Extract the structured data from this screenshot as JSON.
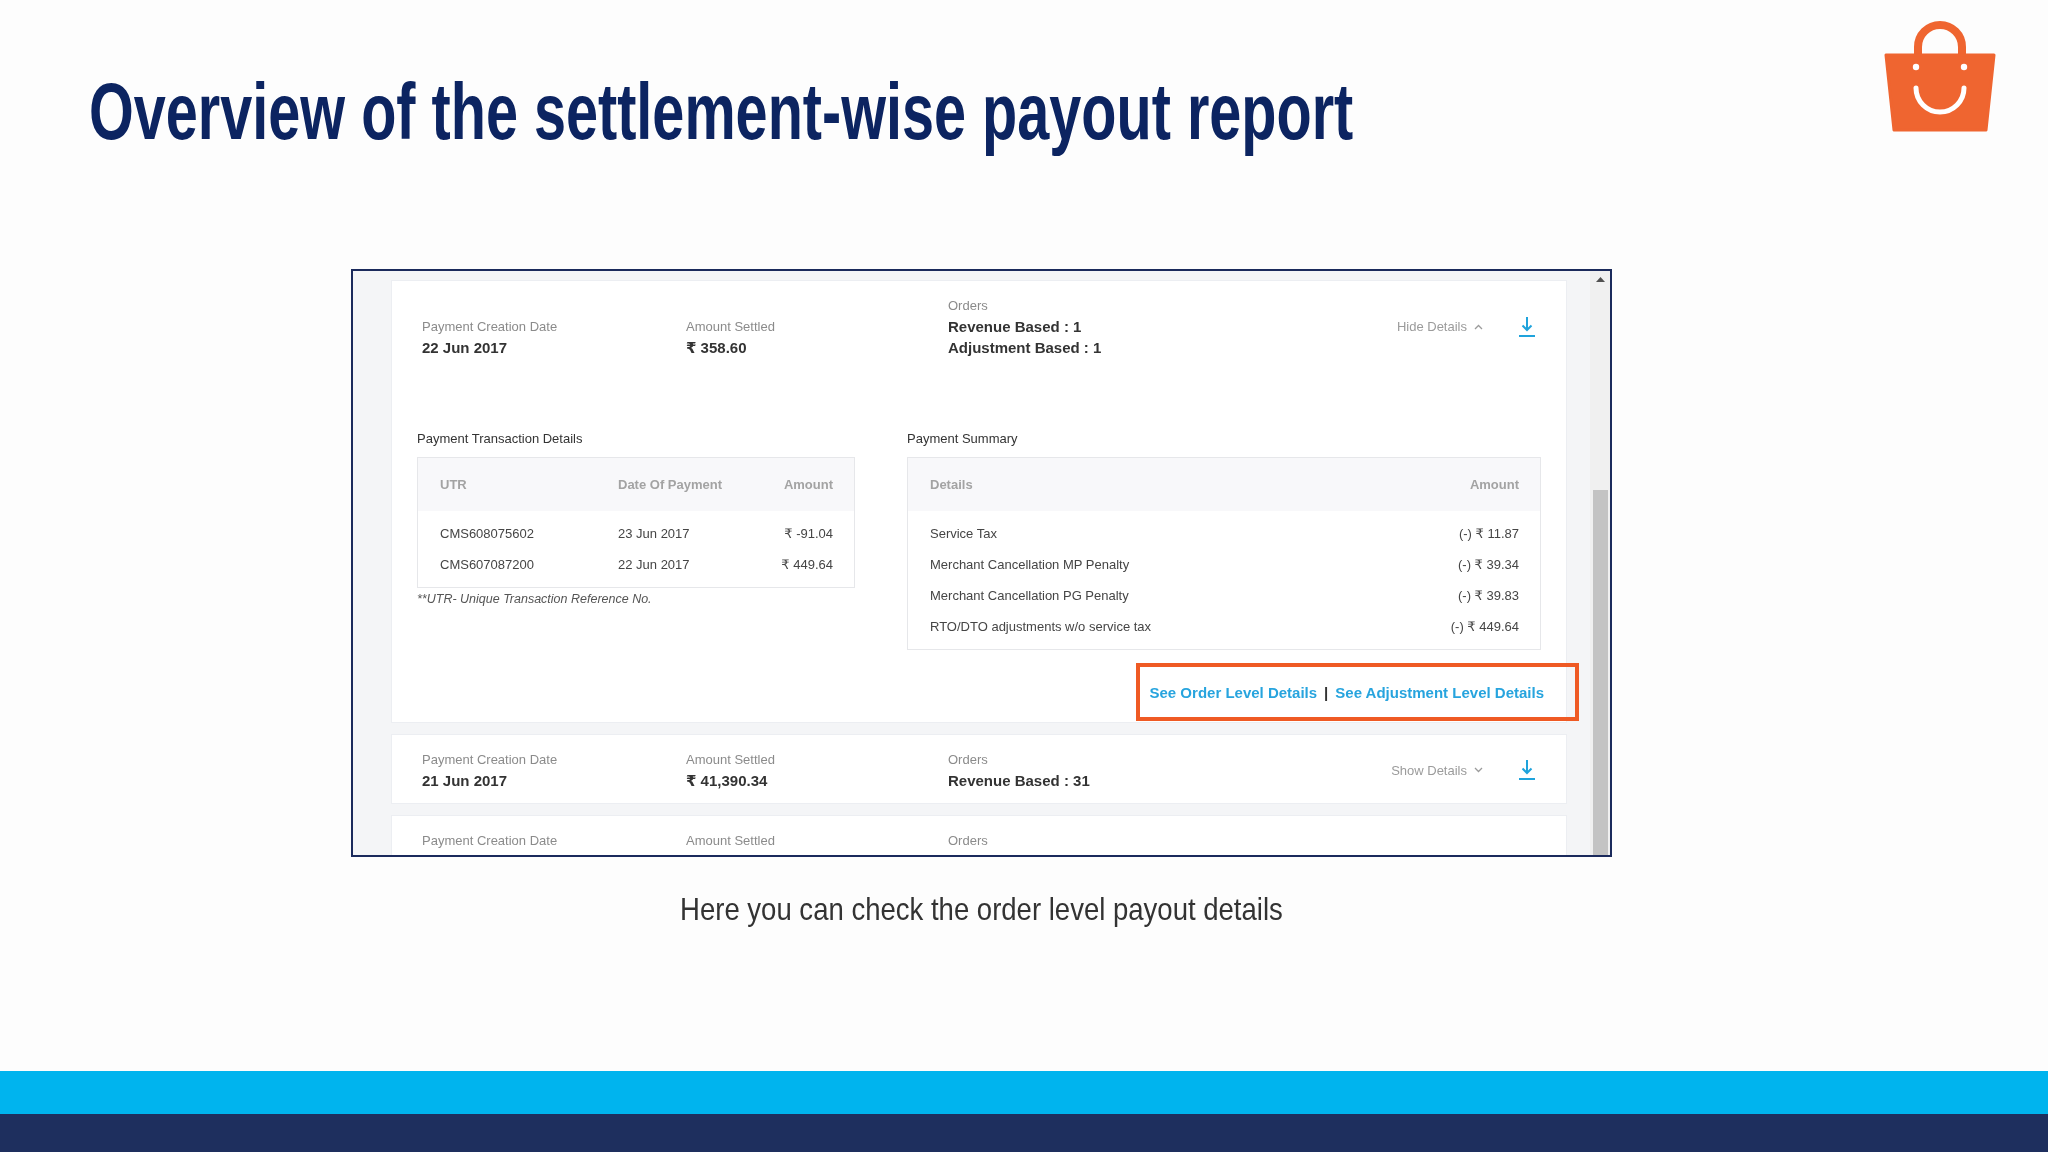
{
  "slide": {
    "title": "Overview of the settlement-wise payout report",
    "caption": "Here you can check the order level payout details"
  },
  "report": {
    "payments": [
      {
        "date_label": "Payment Creation Date",
        "date": "22 Jun 2017",
        "amount_label": "Amount Settled",
        "amount": "₹ 358.60",
        "orders_label": "Orders",
        "orders": [
          "Revenue Based : 1",
          "Adjustment Based : 1"
        ],
        "toggle": "Hide Details",
        "expanded": true,
        "details": {
          "transactions": {
            "title": "Payment Transaction Details",
            "columns": [
              "UTR",
              "Date Of Payment",
              "Amount"
            ],
            "rows": [
              [
                "CMS608075602",
                "23 Jun 2017",
                "₹ -91.04"
              ],
              [
                "CMS607087200",
                "22 Jun 2017",
                "₹ 449.64"
              ]
            ],
            "footnote": "**UTR- Unique Transaction Reference No."
          },
          "summary": {
            "title": "Payment Summary",
            "columns": [
              "Details",
              "Amount"
            ],
            "rows": [
              [
                "Service Tax",
                "(-) ₹ 11.87"
              ],
              [
                "Merchant Cancellation MP Penalty",
                "(-) ₹ 39.34"
              ],
              [
                "Merchant Cancellation PG Penalty",
                "(-) ₹ 39.83"
              ],
              [
                "RTO/DTO adjustments w/o service tax",
                "(-) ₹ 449.64"
              ]
            ]
          },
          "links": {
            "items": [
              "See Order Level Details",
              "See Adjustment Level Details"
            ],
            "separator": "|",
            "highlighted": true
          }
        }
      },
      {
        "date_label": "Payment Creation Date",
        "date": "21 Jun 2017",
        "amount_label": "Amount Settled",
        "amount": "₹ 41,390.34",
        "orders_label": "Orders",
        "orders": [
          "Revenue Based : 31"
        ],
        "toggle": "Show Details",
        "expanded": false
      },
      {
        "date_label": "Payment Creation Date",
        "amount_label": "Amount Settled",
        "orders_label": "Orders"
      }
    ]
  }
}
